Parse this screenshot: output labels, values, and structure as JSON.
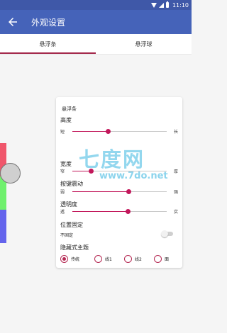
{
  "status_bar": {
    "time": "11:10"
  },
  "app_bar": {
    "title": "外观设置"
  },
  "tabs": [
    {
      "label": "悬浮条",
      "active": true
    },
    {
      "label": "悬浮球",
      "active": false
    }
  ],
  "card": {
    "title": "悬浮条",
    "settings": {
      "height": {
        "label": "高度",
        "min_label": "短",
        "max_label": "长",
        "value": 0.38
      },
      "width": {
        "label": "宽度",
        "min_label": "窄",
        "max_label": "厚",
        "value": 0.2
      },
      "vibration": {
        "label": "按键震动",
        "min_label": "弱",
        "max_label": "强",
        "value": 0.6
      },
      "opacity": {
        "label": "透明度",
        "min_label": "透",
        "max_label": "实",
        "value": 0.59
      }
    },
    "pin": {
      "label": "位置固定",
      "state_text": "不固定",
      "enabled": false
    },
    "theme": {
      "label": "隐藏式主题",
      "options": [
        "传统",
        "线1",
        "线2",
        "面"
      ],
      "selected": "传统"
    }
  },
  "watermark": {
    "text": "七度网",
    "url": "www.7do.net"
  },
  "colors": {
    "status_bar": "#3f58a8",
    "app_bar": "#4563b9",
    "accent": "#c2185b",
    "strip_red": "#f0566b",
    "strip_green": "#6ff06d",
    "strip_blue": "#6464ec"
  }
}
